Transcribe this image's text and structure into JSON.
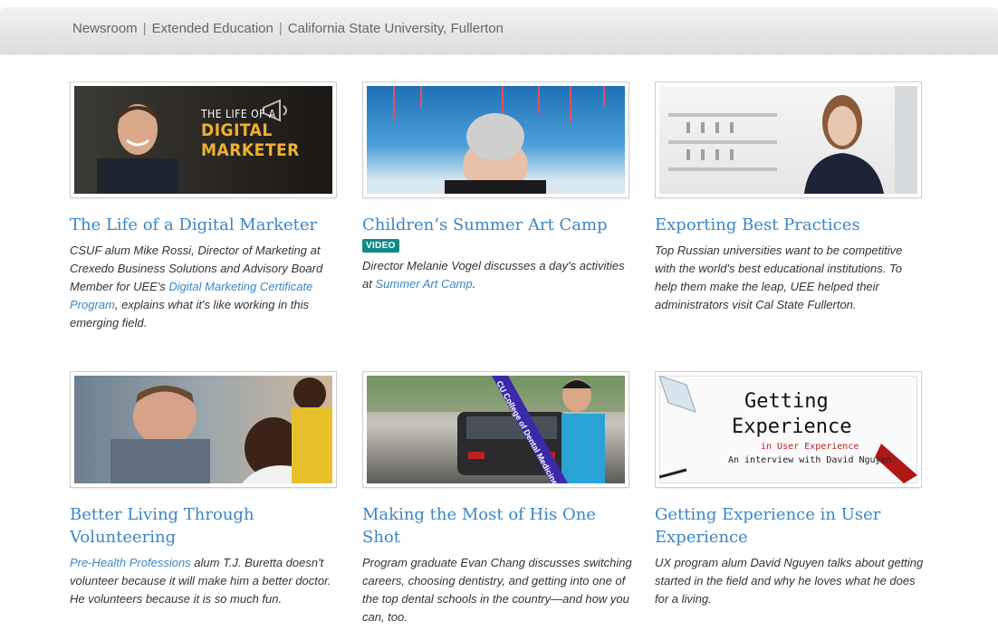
{
  "breadcrumb": [
    "Newsroom",
    "Extended Education",
    "California State University, Fullerton"
  ],
  "cards": [
    {
      "title": "The Life of a Digital Marketer",
      "image_text": [
        "THE LIFE OF A",
        "DIGITAL MARKETER"
      ],
      "desc": {
        "before": "CSUF alum Mike Rossi, Director of Marketing at Crexedo Business Solutions and Advisory Board Member for UEE's ",
        "link": "Digital Marketing Certificate Program",
        "after": ", explains what it's like working in this emerging field."
      }
    },
    {
      "title": "Children’s Summer Art Camp",
      "badge": "VIDEO",
      "desc": {
        "before": "Director Melanie Vogel discusses a day's activities at ",
        "link": "Summer Art Camp",
        "after": "."
      }
    },
    {
      "title": "Exporting Best Practices",
      "desc": {
        "before": "Top Russian universities want to be competitive with the world's best educational institutions. To help them make the leap, UEE helped their administrators visit Cal State Fullerton."
      }
    },
    {
      "title": "Better Living Through Volunteering",
      "desc": {
        "link": "Pre-Health Professions",
        "after": " alum T.J. Buretta doesn't volunteer because it will make him a better doctor. He volunteers because it is so much fun."
      }
    },
    {
      "title": "Making the Most of His One Shot",
      "image_text": [
        "CU College of Dental Medicine"
      ],
      "desc": {
        "before": "Program graduate Evan Chang discusses switching careers, choosing dentistry, and getting into one of the top dental schools in the country—and how you can, too."
      }
    },
    {
      "title": "Getting Experience in User Experience",
      "image_text": [
        "Getting",
        "Experience",
        "in User Experience",
        "An interview with David Nguyen"
      ],
      "desc": {
        "before": "UX program alum David Nguyen talks about getting started in the field and why he loves what he does for a living."
      }
    }
  ],
  "colors": {
    "link": "#3b86c4",
    "badge": "#0f8b83",
    "accent_gold": "#f0b030"
  }
}
